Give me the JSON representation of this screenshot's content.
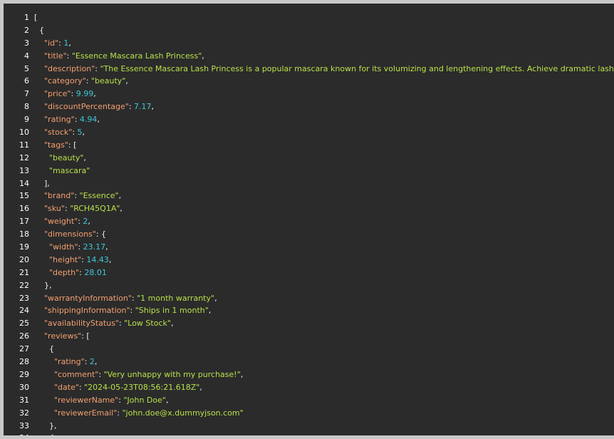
{
  "colors": {
    "background": "#2b2b2b",
    "key": "#f4a070",
    "string": "#b8e04a",
    "number": "#3ec8d8",
    "punctuation": "#f0f0f0"
  },
  "lines": [
    {
      "n": "1",
      "indent": 0,
      "tokens": [
        {
          "t": "punc",
          "v": "["
        }
      ]
    },
    {
      "n": "2",
      "indent": 1,
      "tokens": [
        {
          "t": "punc",
          "v": "{"
        }
      ]
    },
    {
      "n": "3",
      "indent": 2,
      "tokens": [
        {
          "t": "key",
          "v": "\"id\""
        },
        {
          "t": "punc",
          "v": ": "
        },
        {
          "t": "num",
          "v": "1"
        },
        {
          "t": "punc",
          "v": ","
        }
      ]
    },
    {
      "n": "4",
      "indent": 2,
      "tokens": [
        {
          "t": "key",
          "v": "\"title\""
        },
        {
          "t": "punc",
          "v": ": "
        },
        {
          "t": "str",
          "v": "\"Essence Mascara Lash Princess\""
        },
        {
          "t": "punc",
          "v": ","
        }
      ]
    },
    {
      "n": "5",
      "indent": 2,
      "tokens": [
        {
          "t": "key",
          "v": "\"description\""
        },
        {
          "t": "punc",
          "v": ": "
        },
        {
          "t": "str",
          "v": "\"The Essence Mascara Lash Princess is a popular mascara known for its volumizing and lengthening effects. Achieve dramatic lashes wi"
        }
      ]
    },
    {
      "n": "6",
      "indent": 2,
      "tokens": [
        {
          "t": "key",
          "v": "\"category\""
        },
        {
          "t": "punc",
          "v": ": "
        },
        {
          "t": "str",
          "v": "\"beauty\""
        },
        {
          "t": "punc",
          "v": ","
        }
      ]
    },
    {
      "n": "7",
      "indent": 2,
      "tokens": [
        {
          "t": "key",
          "v": "\"price\""
        },
        {
          "t": "punc",
          "v": ": "
        },
        {
          "t": "num",
          "v": "9.99"
        },
        {
          "t": "punc",
          "v": ","
        }
      ]
    },
    {
      "n": "8",
      "indent": 2,
      "tokens": [
        {
          "t": "key",
          "v": "\"discountPercentage\""
        },
        {
          "t": "punc",
          "v": ": "
        },
        {
          "t": "num",
          "v": "7.17"
        },
        {
          "t": "punc",
          "v": ","
        }
      ]
    },
    {
      "n": "9",
      "indent": 2,
      "tokens": [
        {
          "t": "key",
          "v": "\"rating\""
        },
        {
          "t": "punc",
          "v": ": "
        },
        {
          "t": "num",
          "v": "4.94"
        },
        {
          "t": "punc",
          "v": ","
        }
      ]
    },
    {
      "n": "10",
      "indent": 2,
      "tokens": [
        {
          "t": "key",
          "v": "\"stock\""
        },
        {
          "t": "punc",
          "v": ": "
        },
        {
          "t": "num",
          "v": "5"
        },
        {
          "t": "punc",
          "v": ","
        }
      ]
    },
    {
      "n": "11",
      "indent": 2,
      "tokens": [
        {
          "t": "key",
          "v": "\"tags\""
        },
        {
          "t": "punc",
          "v": ": ["
        }
      ]
    },
    {
      "n": "12",
      "indent": 3,
      "tokens": [
        {
          "t": "str",
          "v": "\"beauty\""
        },
        {
          "t": "punc",
          "v": ","
        }
      ]
    },
    {
      "n": "13",
      "indent": 3,
      "tokens": [
        {
          "t": "str",
          "v": "\"mascara\""
        }
      ]
    },
    {
      "n": "14",
      "indent": 2,
      "tokens": [
        {
          "t": "punc",
          "v": "],"
        }
      ]
    },
    {
      "n": "15",
      "indent": 2,
      "tokens": [
        {
          "t": "key",
          "v": "\"brand\""
        },
        {
          "t": "punc",
          "v": ": "
        },
        {
          "t": "str",
          "v": "\"Essence\""
        },
        {
          "t": "punc",
          "v": ","
        }
      ]
    },
    {
      "n": "16",
      "indent": 2,
      "tokens": [
        {
          "t": "key",
          "v": "\"sku\""
        },
        {
          "t": "punc",
          "v": ": "
        },
        {
          "t": "str",
          "v": "\"RCH45Q1A\""
        },
        {
          "t": "punc",
          "v": ","
        }
      ]
    },
    {
      "n": "17",
      "indent": 2,
      "tokens": [
        {
          "t": "key",
          "v": "\"weight\""
        },
        {
          "t": "punc",
          "v": ": "
        },
        {
          "t": "num",
          "v": "2"
        },
        {
          "t": "punc",
          "v": ","
        }
      ]
    },
    {
      "n": "18",
      "indent": 2,
      "tokens": [
        {
          "t": "key",
          "v": "\"dimensions\""
        },
        {
          "t": "punc",
          "v": ": {"
        }
      ]
    },
    {
      "n": "19",
      "indent": 3,
      "tokens": [
        {
          "t": "key",
          "v": "\"width\""
        },
        {
          "t": "punc",
          "v": ": "
        },
        {
          "t": "num",
          "v": "23.17"
        },
        {
          "t": "punc",
          "v": ","
        }
      ]
    },
    {
      "n": "20",
      "indent": 3,
      "tokens": [
        {
          "t": "key",
          "v": "\"height\""
        },
        {
          "t": "punc",
          "v": ": "
        },
        {
          "t": "num",
          "v": "14.43"
        },
        {
          "t": "punc",
          "v": ","
        }
      ]
    },
    {
      "n": "21",
      "indent": 3,
      "tokens": [
        {
          "t": "key",
          "v": "\"depth\""
        },
        {
          "t": "punc",
          "v": ": "
        },
        {
          "t": "num",
          "v": "28.01"
        }
      ]
    },
    {
      "n": "22",
      "indent": 2,
      "tokens": [
        {
          "t": "punc",
          "v": "},"
        }
      ]
    },
    {
      "n": "23",
      "indent": 2,
      "tokens": [
        {
          "t": "key",
          "v": "\"warrantyInformation\""
        },
        {
          "t": "punc",
          "v": ": "
        },
        {
          "t": "str",
          "v": "\"1 month warranty\""
        },
        {
          "t": "punc",
          "v": ","
        }
      ]
    },
    {
      "n": "24",
      "indent": 2,
      "tokens": [
        {
          "t": "key",
          "v": "\"shippingInformation\""
        },
        {
          "t": "punc",
          "v": ": "
        },
        {
          "t": "str",
          "v": "\"Ships in 1 month\""
        },
        {
          "t": "punc",
          "v": ","
        }
      ]
    },
    {
      "n": "25",
      "indent": 2,
      "tokens": [
        {
          "t": "key",
          "v": "\"availabilityStatus\""
        },
        {
          "t": "punc",
          "v": ": "
        },
        {
          "t": "str",
          "v": "\"Low Stock\""
        },
        {
          "t": "punc",
          "v": ","
        }
      ]
    },
    {
      "n": "26",
      "indent": 2,
      "tokens": [
        {
          "t": "key",
          "v": "\"reviews\""
        },
        {
          "t": "punc",
          "v": ": ["
        }
      ]
    },
    {
      "n": "27",
      "indent": 3,
      "tokens": [
        {
          "t": "punc",
          "v": "{"
        }
      ]
    },
    {
      "n": "28",
      "indent": 4,
      "tokens": [
        {
          "t": "key",
          "v": "\"rating\""
        },
        {
          "t": "punc",
          "v": ": "
        },
        {
          "t": "num",
          "v": "2"
        },
        {
          "t": "punc",
          "v": ","
        }
      ]
    },
    {
      "n": "29",
      "indent": 4,
      "tokens": [
        {
          "t": "key",
          "v": "\"comment\""
        },
        {
          "t": "punc",
          "v": ": "
        },
        {
          "t": "str",
          "v": "\"Very unhappy with my purchase!\""
        },
        {
          "t": "punc",
          "v": ","
        }
      ]
    },
    {
      "n": "30",
      "indent": 4,
      "tokens": [
        {
          "t": "key",
          "v": "\"date\""
        },
        {
          "t": "punc",
          "v": ": "
        },
        {
          "t": "str",
          "v": "\"2024-05-23T08:56:21.618Z\""
        },
        {
          "t": "punc",
          "v": ","
        }
      ]
    },
    {
      "n": "31",
      "indent": 4,
      "tokens": [
        {
          "t": "key",
          "v": "\"reviewerName\""
        },
        {
          "t": "punc",
          "v": ": "
        },
        {
          "t": "str",
          "v": "\"John Doe\""
        },
        {
          "t": "punc",
          "v": ","
        }
      ]
    },
    {
      "n": "32",
      "indent": 4,
      "tokens": [
        {
          "t": "key",
          "v": "\"reviewerEmail\""
        },
        {
          "t": "punc",
          "v": ": "
        },
        {
          "t": "str",
          "v": "\"john.doe@x.dummyjson.com\""
        }
      ]
    },
    {
      "n": "33",
      "indent": 3,
      "tokens": [
        {
          "t": "punc",
          "v": "},"
        }
      ]
    },
    {
      "n": "34",
      "indent": 3,
      "tokens": [
        {
          "t": "punc",
          "v": "{"
        }
      ]
    }
  ]
}
